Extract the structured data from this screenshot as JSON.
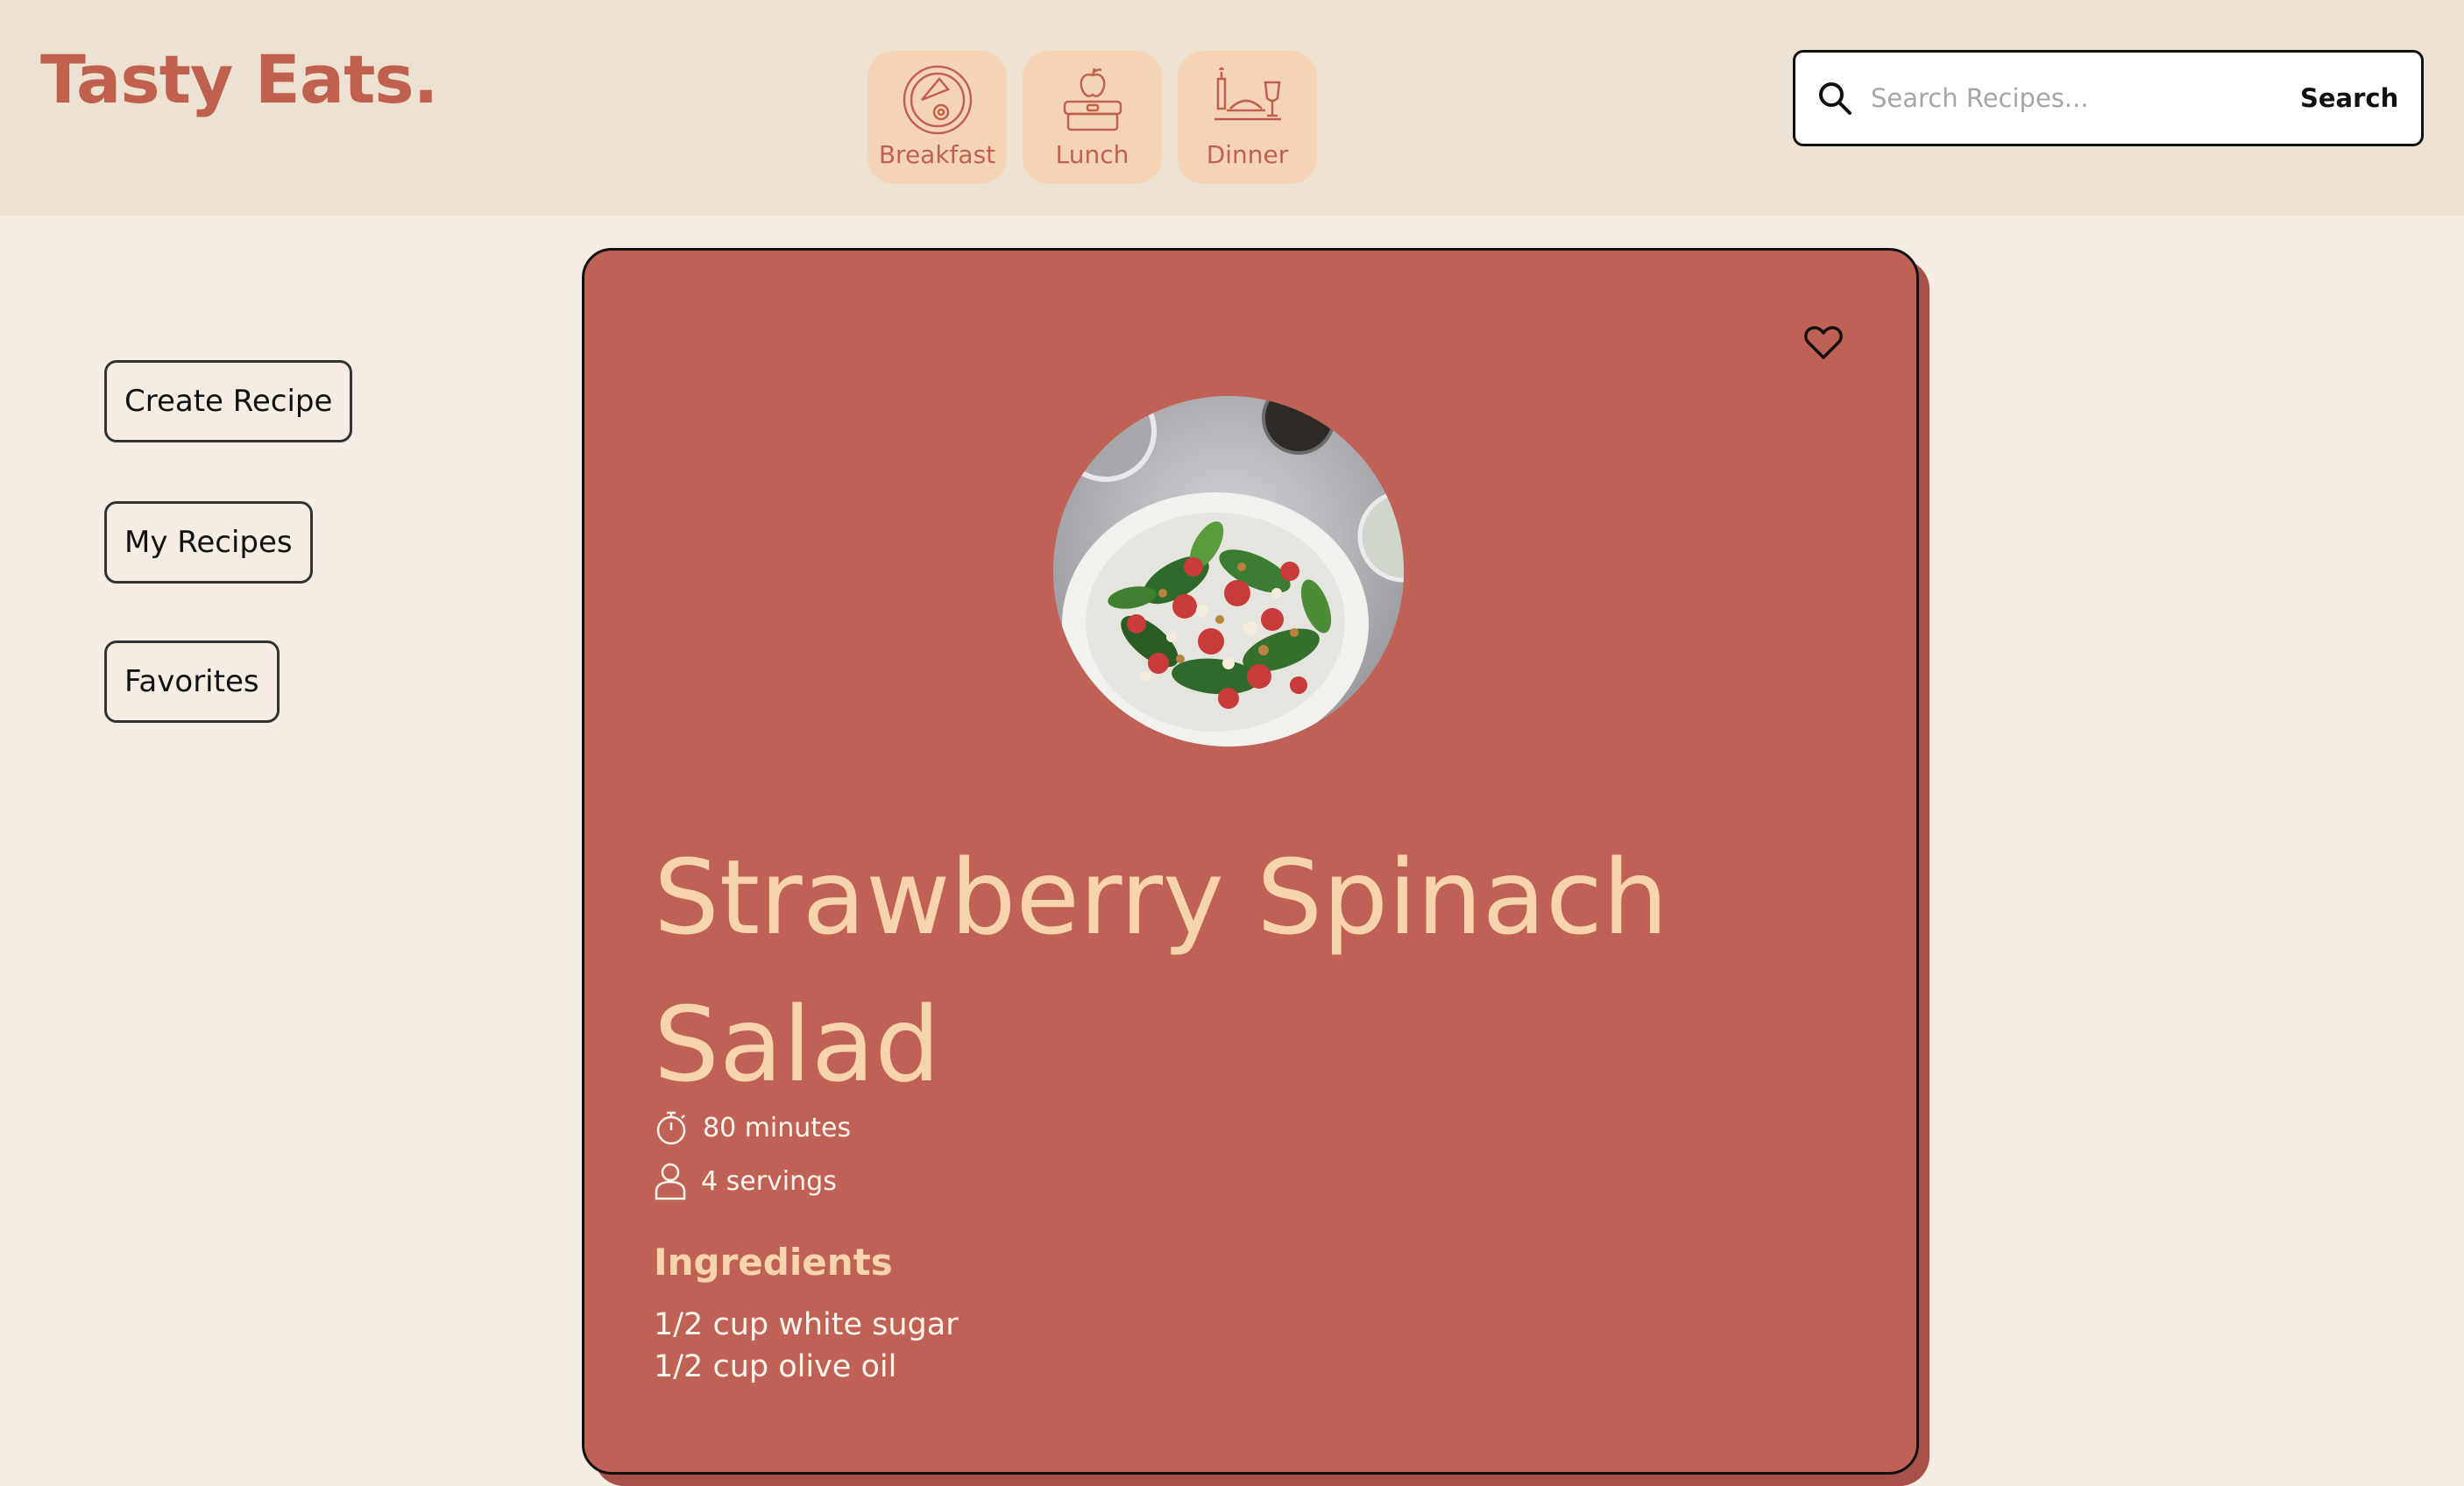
{
  "brand": {
    "logo_text": "Tasty Eats."
  },
  "categories": [
    {
      "label": "Breakfast",
      "icon": "breakfast-plate-icon"
    },
    {
      "label": "Lunch",
      "icon": "lunchbox-apple-icon"
    },
    {
      "label": "Dinner",
      "icon": "dinner-table-icon"
    }
  ],
  "search": {
    "placeholder": "Search Recipes...",
    "value": "",
    "button_label": "Search"
  },
  "sidebar": {
    "items": [
      {
        "label": "Create Recipe"
      },
      {
        "label": "My Recipes"
      },
      {
        "label": "Favorites"
      }
    ]
  },
  "recipe": {
    "title_line1": "Strawberry Spinach",
    "title_line2": "Salad",
    "time": "80 minutes",
    "servings": "4 servings",
    "ingredients_heading": "Ingredients",
    "ingredients": [
      "1/2 cup white sugar",
      "1/2 cup olive oil"
    ],
    "favorited": false
  },
  "colors": {
    "accent": "#c0604f",
    "header_bg": "#ede2d1",
    "page_bg": "#f5ede3",
    "card_bg": "#bf6255",
    "category_bg": "#f5d4b5",
    "title_text": "#f7d4ad"
  }
}
